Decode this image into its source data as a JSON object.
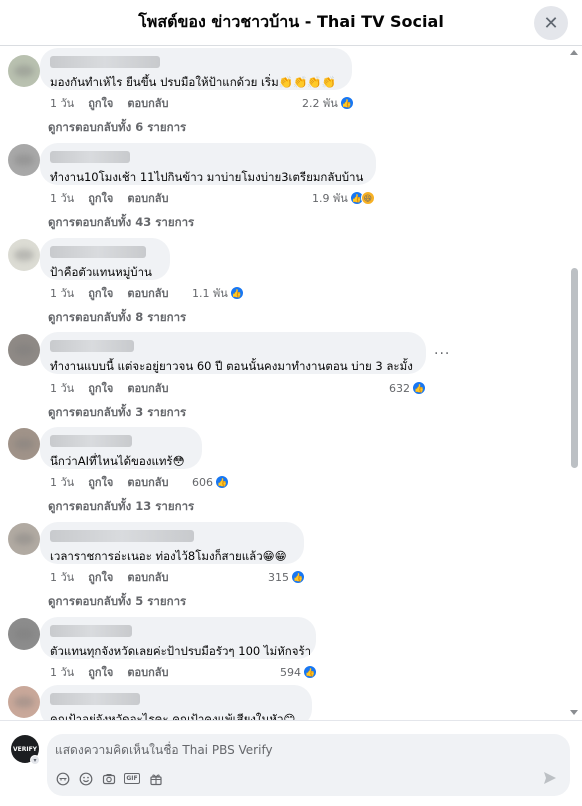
{
  "header": {
    "title": "โพสต์ของ ข่าวชาวบ้าน - Thai TV Social",
    "close_symbol": "✕"
  },
  "actions": {
    "like": "ถูกใจ",
    "reply": "ตอบกลับ"
  },
  "comments": [
    {
      "text": "มองกันทำเห้ไร ยืนขึ้น ปรบมือให้ป้าแกด้วย เริ่ม👏👏👏👏",
      "time": "1 วัน",
      "reactions": "2.2 พัน",
      "reaction_types": [
        "like-icon"
      ],
      "replies": "ดูการตอบกลับทั้ง 6 รายการ"
    },
    {
      "text": "ทำงาน10โมงเช้า 11ไปกินข้าว มาบ่ายโมงบ่าย3เตรียมกลับบ้าน",
      "time": "1 วัน",
      "reactions": "1.9 พัน",
      "reaction_types": [
        "like-icon",
        "haha-icon"
      ],
      "replies": "ดูการตอบกลับทั้ง 43 รายการ"
    },
    {
      "text": "ป้าคือตัวแทนหมู่บ้าน",
      "time": "1 วัน",
      "reactions": "1.1 พัน",
      "reaction_types": [
        "like-icon"
      ],
      "replies": "ดูการตอบกลับทั้ง 8 รายการ"
    },
    {
      "text": "ทำงานแบบนี้ แต่จะอยู่ยาวจน 60 ปี ตอนนั้นคงมาทำงานตอน บ่าย 3 ละมั้ง",
      "time": "1 วัน",
      "reactions": "632",
      "reaction_types": [
        "like-icon"
      ],
      "replies": "ดูการตอบกลับทั้ง 3 รายการ",
      "more": "···"
    },
    {
      "text": "นึกว่าAIที่ไหนได้ของแทร้😳",
      "time": "1 วัน",
      "reactions": "606",
      "reaction_types": [
        "like-icon"
      ],
      "replies": "ดูการตอบกลับทั้ง 13 รายการ"
    },
    {
      "text": "เวลาราชการอ่ะเนอะ ท่องไว้8โมงก็สายแล้ว😁😁",
      "time": "1 วัน",
      "reactions": "315",
      "reaction_types": [
        "like-icon"
      ],
      "replies": "ดูการตอบกลับทั้ง 5 รายการ"
    },
    {
      "text": "ตัวแทนทุกจังหวัดเลยค่ะป้าปรบมือรัวๆ 100 ไม่หักจร้า",
      "time": "1 วัน",
      "reactions": "594",
      "reaction_types": [
        "like-icon"
      ],
      "replies": ""
    },
    {
      "text": "คุณป้าอยู่จังหวัดอะไรคะ คุณป้าคงแพ้เสียงในหัว😊",
      "time": "",
      "reactions": "",
      "reaction_types": [],
      "replies": ""
    }
  ],
  "composer": {
    "placeholder": "แสดงความคิดเห็นในชื่อ Thai PBS Verify",
    "avatar_text": "VERIFY",
    "icons": [
      "sticker-icon",
      "emoji-icon",
      "camera-icon",
      "gif-icon",
      "gift-icon"
    ],
    "gif_label": "GIF"
  },
  "colors": {
    "accent": "#1877f2",
    "bubble": "#f0f2f5",
    "muted": "#65676b"
  }
}
